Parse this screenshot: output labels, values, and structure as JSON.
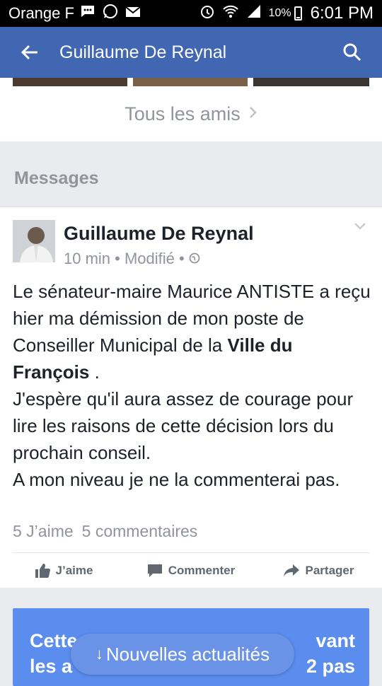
{
  "status_bar": {
    "carrier": "Orange F",
    "battery": "10%",
    "time": "6:01 PM",
    "icons": [
      "messenger-icon",
      "whatsapp-icon",
      "mail-icon",
      "alarm-icon",
      "wifi-icon",
      "signal-icon",
      "battery-icon"
    ]
  },
  "header": {
    "title": "Guillaume De Reynal",
    "back_icon": "arrow-back-icon",
    "search_icon": "search-icon",
    "background": "#4267b2"
  },
  "friends": {
    "all_friends_label": "Tous les amis"
  },
  "section": {
    "title": "Messages"
  },
  "post": {
    "author": "Guillaume De Reynal",
    "time": "10 min",
    "edited": "Modifié",
    "paragraphs": [
      "Le sénateur-maire Maurice ANTISTE a reçu hier ma démission de mon poste de Conseiller Municipal de la",
      "Ville du François",
      " .",
      "J'espère qu'il aura assez de courage pour lire les raisons de cette décision lors du prochain conseil.",
      "A mon niveau je ne la commenterai pas."
    ],
    "likes": "5 J’aime",
    "comments": "5 commentaires",
    "actions": {
      "like": "J’aime",
      "comment": "Commenter",
      "share": "Partager"
    }
  },
  "promo": {
    "line1_start": "Cette",
    "line1_end": "vant",
    "line2_start": "les a",
    "line2_end": "2 pas",
    "color": "#5b8def"
  },
  "toast": {
    "label": "Nouvelles actualités"
  }
}
